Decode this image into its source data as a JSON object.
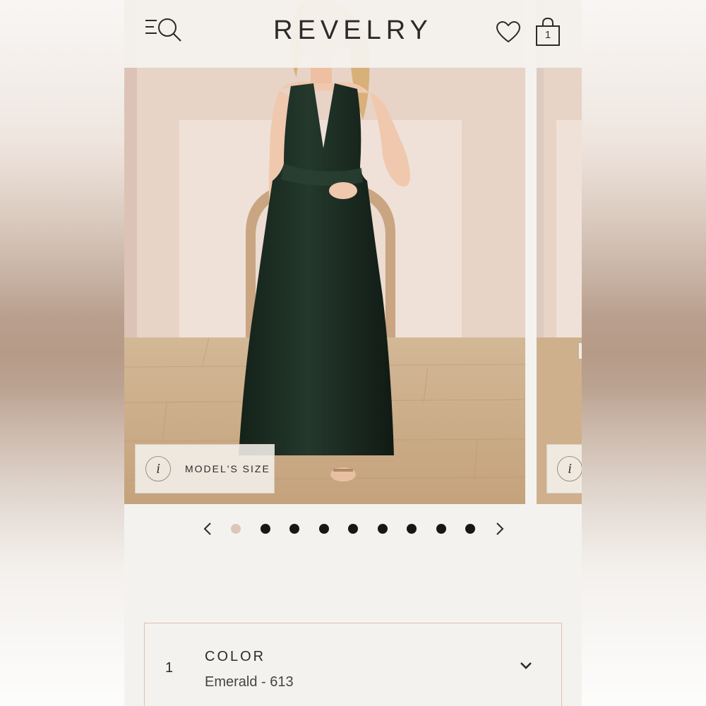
{
  "header": {
    "logo": "REVELRY",
    "menu_icon": "menu-search-icon",
    "wishlist_icon": "heart-icon",
    "cart_icon": "shopping-bag-icon",
    "cart_count": "1"
  },
  "gallery": {
    "model_size_label": "MODEL'S SIZE",
    "info_glyph": "i",
    "slide_count": 9,
    "active_slide": 1,
    "prev_icon": "chevron-left-icon",
    "next_icon": "chevron-right-icon"
  },
  "selector": {
    "step": "1",
    "label": "COLOR",
    "value": "Emerald - 613",
    "toggle_icon": "chevron-down-icon"
  },
  "colors": {
    "page_bg": "#f4f2ee",
    "dress": "#1b2b22",
    "wall": "#e6cfc3",
    "floor": "#c9a985",
    "active_dot": "#dcc5b9",
    "dot": "#171717"
  }
}
